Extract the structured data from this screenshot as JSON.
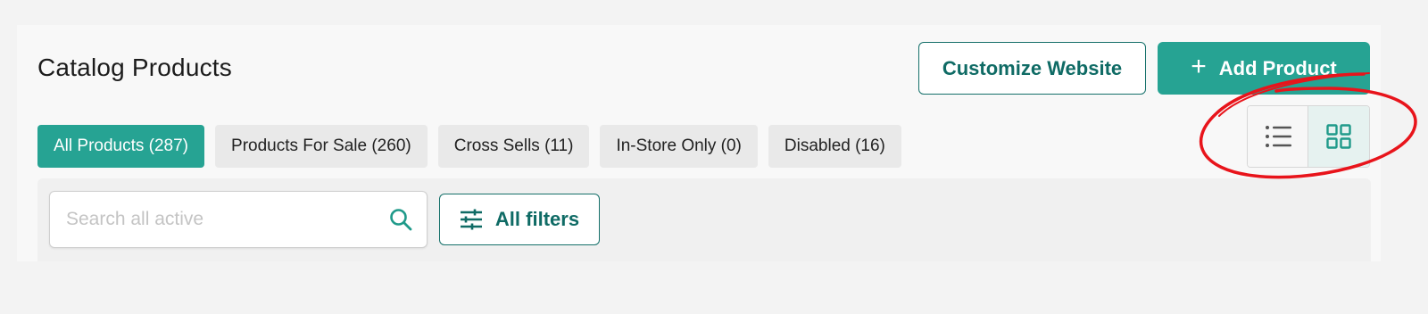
{
  "header": {
    "title": "Catalog Products",
    "customize_label": "Customize Website",
    "add_label": "Add Product"
  },
  "tabs": [
    {
      "label": "All Products (287)",
      "active": true
    },
    {
      "label": "Products For Sale (260)",
      "active": false
    },
    {
      "label": "Cross Sells (11)",
      "active": false
    },
    {
      "label": "In-Store Only (0)",
      "active": false
    },
    {
      "label": "Disabled (16)",
      "active": false
    }
  ],
  "view_toggle": {
    "options": [
      "list-view",
      "grid-view"
    ],
    "selected": "grid-view"
  },
  "search": {
    "placeholder": "Search all active",
    "value": ""
  },
  "filters": {
    "label": "All filters"
  },
  "colors": {
    "accent": "#26a393",
    "accent_dark": "#0f6b65",
    "annotation": "#e8141b"
  },
  "icons": [
    "plus-icon",
    "list-view-icon",
    "grid-view-icon",
    "search-icon",
    "filter-sliders-icon"
  ]
}
